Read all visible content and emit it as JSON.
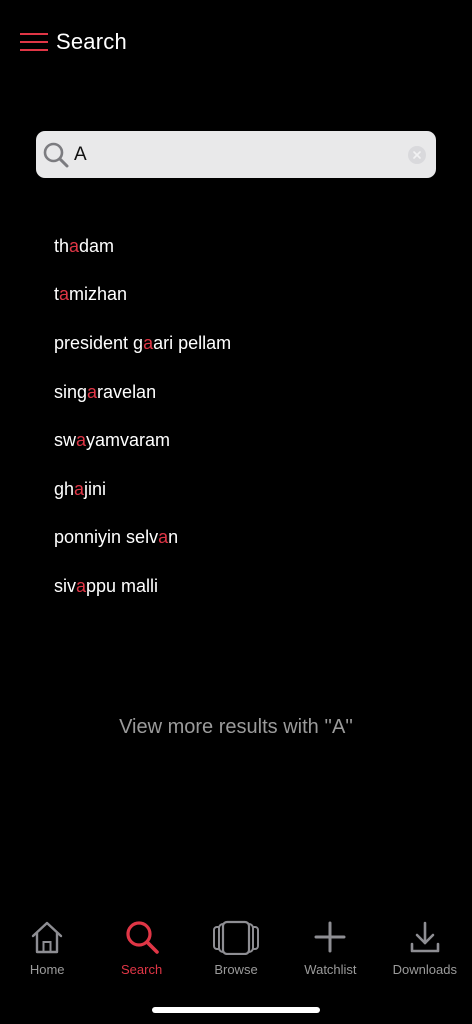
{
  "header": {
    "title": "Search",
    "menu_icon": "hamburger-menu-icon"
  },
  "search": {
    "value": "A",
    "placeholder": "",
    "icon": "search-icon",
    "clear_icon": "clear-icon"
  },
  "colors": {
    "accent": "#e03646",
    "background": "#000000",
    "muted": "#9b9b9b",
    "search_box": "#e9e9ea"
  },
  "results": [
    {
      "before": "th",
      "match": "a",
      "after": "dam"
    },
    {
      "before": "t",
      "match": "a",
      "after": "mizhan"
    },
    {
      "before": "president g",
      "match": "a",
      "after": "ari pellam"
    },
    {
      "before": "sing",
      "match": "a",
      "after": "ravelan"
    },
    {
      "before": "sw",
      "match": "a",
      "after": "yamvaram"
    },
    {
      "before": "gh",
      "match": "a",
      "after": "jini"
    },
    {
      "before": "ponniyin selv",
      "match": "a",
      "after": "n"
    },
    {
      "before": "siv",
      "match": "a",
      "after": "ppu malli"
    }
  ],
  "view_more": "View more results with ''A''",
  "tabs": [
    {
      "label": "Home",
      "icon": "home-icon",
      "active": false
    },
    {
      "label": "Search",
      "icon": "search-icon",
      "active": true
    },
    {
      "label": "Browse",
      "icon": "browse-stack-icon",
      "active": false
    },
    {
      "label": "Watchlist",
      "icon": "plus-icon",
      "active": false
    },
    {
      "label": "Downloads",
      "icon": "download-icon",
      "active": false
    }
  ]
}
